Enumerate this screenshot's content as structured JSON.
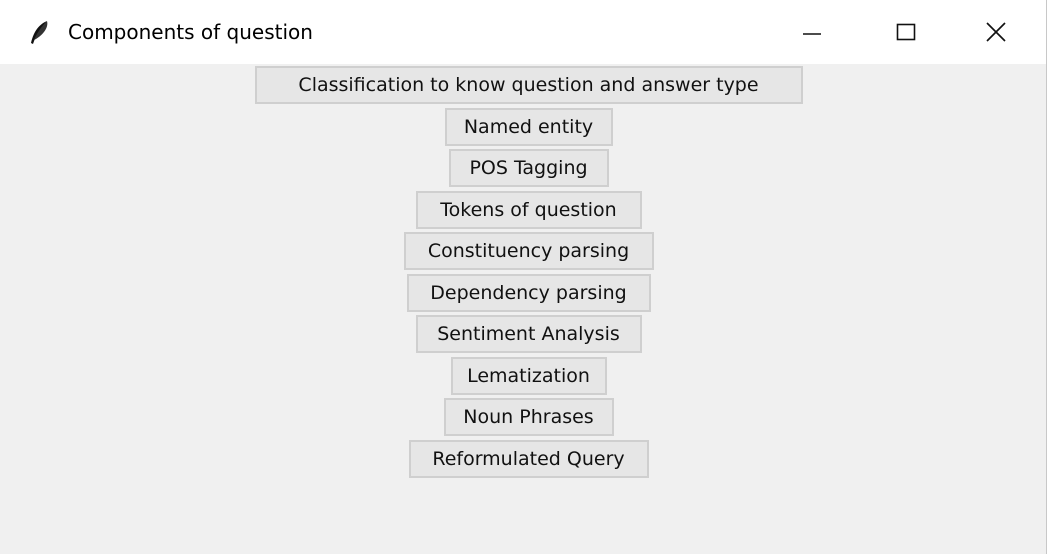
{
  "window": {
    "title": "Components of question",
    "app_icon": "feather-icon",
    "controls": {
      "minimize": "minimize-icon",
      "maximize": "maximize-icon",
      "close": "close-icon"
    }
  },
  "buttons": [
    {
      "label": "Classification to know question and answer type",
      "width": 548
    },
    {
      "label": "Named entity",
      "width": 168
    },
    {
      "label": "POS Tagging",
      "width": 160
    },
    {
      "label": "Tokens of question",
      "width": 226
    },
    {
      "label": "Constituency parsing",
      "width": 250
    },
    {
      "label": "Dependency parsing",
      "width": 244
    },
    {
      "label": "Sentiment Analysis",
      "width": 226
    },
    {
      "label": "Lematization",
      "width": 156
    },
    {
      "label": "Noun Phrases",
      "width": 170
    },
    {
      "label": "Reformulated Query",
      "width": 240
    }
  ]
}
